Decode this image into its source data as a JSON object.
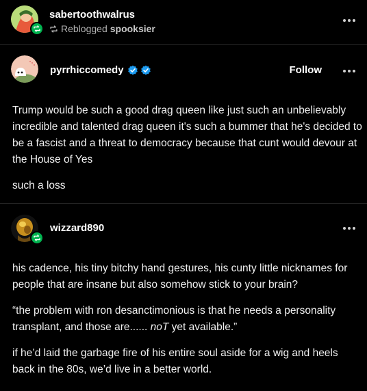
{
  "header": {
    "username": "sabertoothwalrus",
    "reblogged_text": "Reblogged",
    "reblogged_from": "spooksier"
  },
  "post1": {
    "username": "pyrrhiccomedy",
    "follow_label": "Follow",
    "paragraphs": [
      "Trump would be such a good drag queen like just such an unbelievably incredible and talented drag queen it's such a bummer that he's decided to be a fascist and a threat to democracy because that cunt would devour at the House of Yes",
      "such a loss"
    ]
  },
  "post2": {
    "username": "wizzard890",
    "p1": "his cadence, his tiny bitchy hand gestures, his cunty little nicknames for people that are insane but also somehow stick to your brain?",
    "p2_before": "“the problem with ron desanctimonious is that he needs a personality transplant, and those are...... ",
    "p2_em": "noT",
    "p2_after": " yet available.”",
    "p3": "if he’d laid the garbage fire of his entire soul aside for a wig and heels back in the 80s, we’d live in a better world."
  },
  "colors": {
    "background": "#000000",
    "reblog_green": "#00b34f",
    "verified_blue": "#1d9bf0",
    "divider": "#262626"
  }
}
